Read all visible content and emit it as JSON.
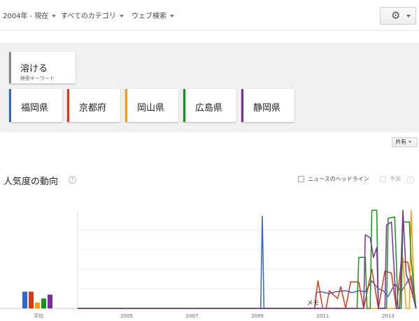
{
  "filters": [
    {
      "label": "2004年 - 現在"
    },
    {
      "label": "すべてのカテゴリ"
    },
    {
      "label": "ウェブ検索"
    }
  ],
  "settings": {
    "icon": "gear-icon"
  },
  "keyword": {
    "title": "溶ける",
    "subtitle": "検索キーワード"
  },
  "terms": [
    {
      "label": "福岡県",
      "color": "#3366cc"
    },
    {
      "label": "京都府",
      "color": "#dc3912"
    },
    {
      "label": "岡山県",
      "color": "#ff9900"
    },
    {
      "label": "広島県",
      "color": "#109618"
    },
    {
      "label": "静岡県",
      "color": "#7b2d9e"
    }
  ],
  "share": {
    "label": "共有"
  },
  "section": {
    "title": "人気度の動向",
    "help": "?",
    "news_headlines_label": "ニュースのヘッドライン",
    "forecast_label": "予測",
    "forecast_help": "?"
  },
  "chart_data": {
    "type": "line",
    "average_label": "平均",
    "note_label": "メモ",
    "x_ticks": [
      "2005",
      "2007",
      "2009",
      "2011",
      "2013"
    ],
    "averages": [
      {
        "name": "福岡県",
        "value": 17
      },
      {
        "name": "京都府",
        "value": 17
      },
      {
        "name": "岡山県",
        "value": 6
      },
      {
        "name": "広島県",
        "value": 10
      },
      {
        "name": "静岡県",
        "value": 14
      }
    ],
    "ylim": [
      0,
      100
    ],
    "series": [
      {
        "name": "福岡県",
        "points": [
          [
            2004.0,
            0
          ],
          [
            2009.6,
            0
          ],
          [
            2009.65,
            94
          ],
          [
            2009.7,
            0
          ],
          [
            2011.25,
            0
          ],
          [
            2011.3,
            16
          ],
          [
            2011.45,
            17
          ],
          [
            2011.7,
            15
          ],
          [
            2011.9,
            17
          ],
          [
            2012.2,
            18
          ],
          [
            2012.4,
            16
          ],
          [
            2012.6,
            18
          ],
          [
            2012.8,
            17
          ],
          [
            2013.0,
            28
          ],
          [
            2013.2,
            20
          ],
          [
            2013.35,
            18
          ],
          [
            2013.5,
            12
          ],
          [
            2013.7,
            25
          ],
          [
            2013.9,
            17
          ],
          [
            2014.2,
            33
          ],
          [
            2014.35,
            0
          ]
        ]
      },
      {
        "name": "京都府",
        "points": [
          [
            2004.0,
            0
          ],
          [
            2011.25,
            0
          ],
          [
            2011.35,
            28
          ],
          [
            2011.5,
            0
          ],
          [
            2011.6,
            0
          ],
          [
            2011.7,
            18
          ],
          [
            2011.95,
            10
          ],
          [
            2012.05,
            22
          ],
          [
            2012.2,
            0
          ],
          [
            2012.35,
            27
          ],
          [
            2012.6,
            27
          ],
          [
            2012.75,
            0
          ],
          [
            2013.0,
            40
          ],
          [
            2013.2,
            0
          ],
          [
            2013.4,
            38
          ],
          [
            2013.6,
            36
          ],
          [
            2013.75,
            0
          ],
          [
            2013.9,
            48
          ],
          [
            2014.1,
            47
          ],
          [
            2014.35,
            0
          ]
        ]
      },
      {
        "name": "岡山県",
        "points": [
          [
            2004.0,
            0
          ],
          [
            2013.85,
            0
          ],
          [
            2013.95,
            52
          ],
          [
            2014.05,
            0
          ],
          [
            2014.15,
            0
          ],
          [
            2014.2,
            100
          ],
          [
            2014.3,
            12
          ],
          [
            2014.35,
            0
          ]
        ]
      },
      {
        "name": "広島県",
        "points": [
          [
            2004.0,
            0
          ],
          [
            2012.55,
            0
          ],
          [
            2012.6,
            52
          ],
          [
            2012.8,
            52
          ],
          [
            2012.85,
            0
          ],
          [
            2012.95,
            0
          ],
          [
            2013.0,
            100
          ],
          [
            2013.15,
            100
          ],
          [
            2013.2,
            0
          ],
          [
            2013.45,
            0
          ],
          [
            2013.5,
            92
          ],
          [
            2013.7,
            93
          ],
          [
            2013.8,
            0
          ],
          [
            2013.9,
            0
          ],
          [
            2013.95,
            88
          ],
          [
            2014.15,
            88
          ],
          [
            2014.2,
            50
          ],
          [
            2014.35,
            0
          ]
        ]
      },
      {
        "name": "静岡県",
        "points": [
          [
            2004.0,
            0
          ],
          [
            2012.75,
            0
          ],
          [
            2012.8,
            75
          ],
          [
            2012.95,
            72
          ],
          [
            2013.05,
            52
          ],
          [
            2013.15,
            62
          ],
          [
            2013.2,
            0
          ],
          [
            2013.4,
            0
          ],
          [
            2013.45,
            85
          ],
          [
            2013.6,
            88
          ],
          [
            2013.75,
            0
          ],
          [
            2013.85,
            0
          ],
          [
            2013.95,
            100
          ],
          [
            2014.05,
            35
          ],
          [
            2014.2,
            20
          ],
          [
            2014.35,
            0
          ]
        ]
      }
    ]
  }
}
